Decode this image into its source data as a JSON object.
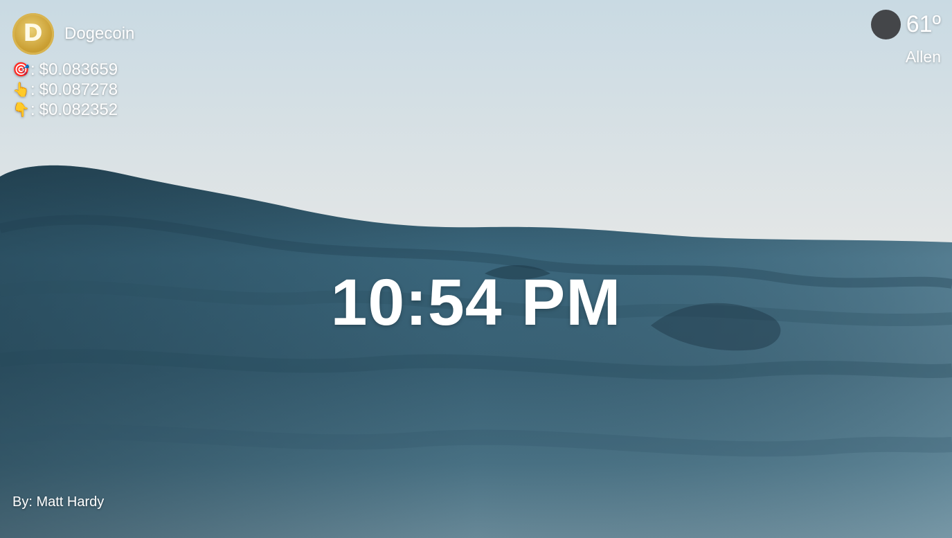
{
  "crypto": {
    "name": "Dogecoin",
    "logo_letter": "D",
    "prices": [
      {
        "icon": "🎯",
        "icon_name": "target-icon",
        "separator": ":",
        "value": "$0.083659"
      },
      {
        "icon": "👆",
        "icon_name": "pointing-up-icon",
        "separator": ":",
        "value": "$0.087278"
      },
      {
        "icon": "👇",
        "icon_name": "pointing-down-icon",
        "separator": ":",
        "value": "$0.082352"
      }
    ]
  },
  "weather": {
    "temperature": "61º",
    "city": "Allen",
    "icon_name": "weather-icon"
  },
  "clock": {
    "time": "10:54 PM"
  },
  "footer": {
    "credit": "By: Matt Hardy"
  },
  "colors": {
    "text": "#ffffff",
    "weather_icon": "#444649",
    "coin_gold": "#cba034"
  }
}
